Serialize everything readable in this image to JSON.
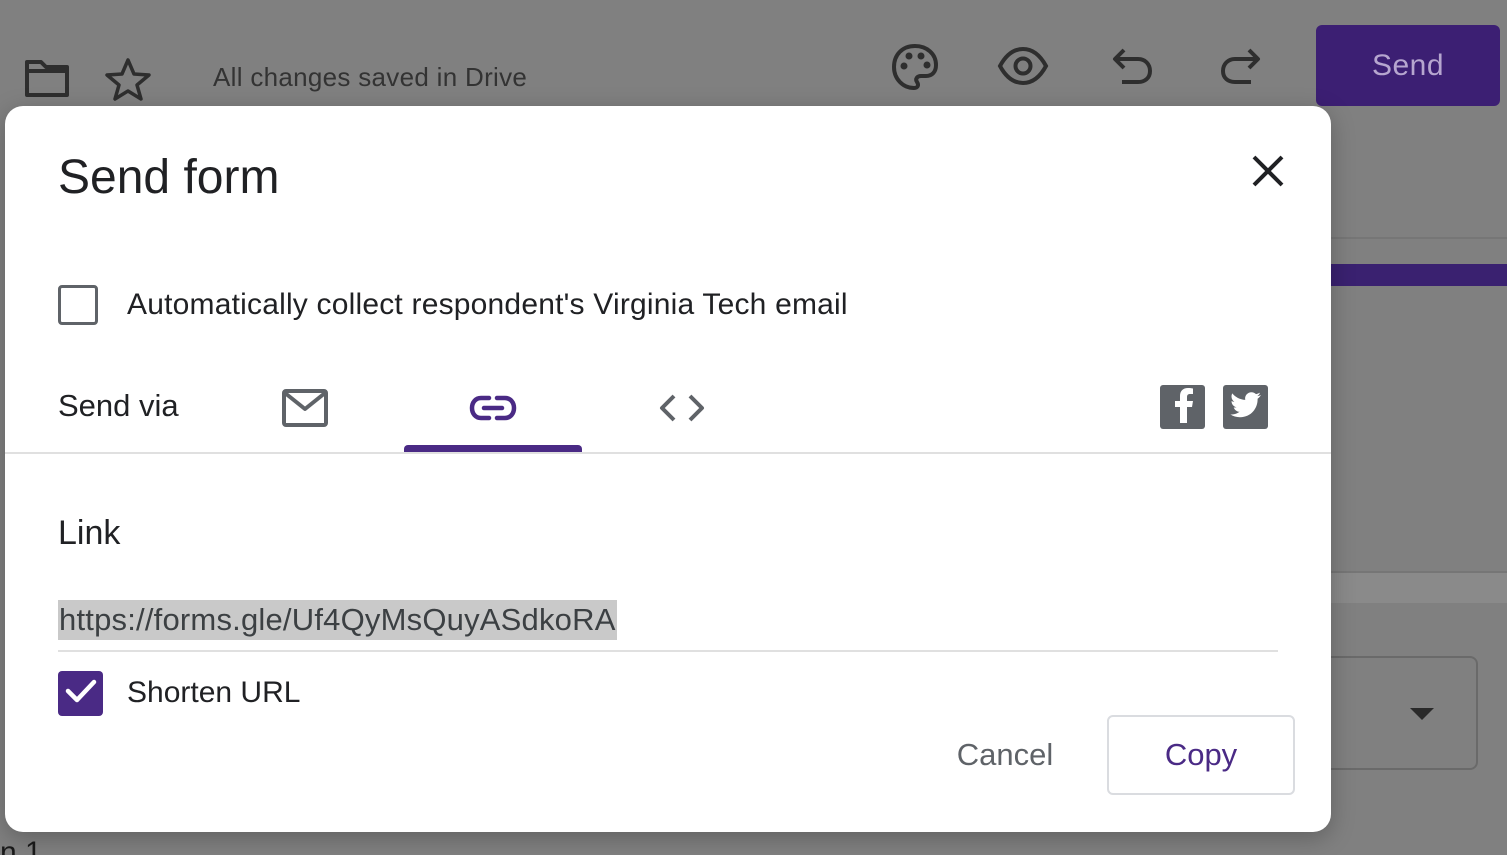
{
  "background": {
    "status_text": "All changes saved in Drive",
    "send_button_label": "Send",
    "edge_text": "n 1",
    "icons": [
      "folder-icon",
      "star-icon",
      "palette-icon",
      "eye-icon",
      "undo-icon",
      "redo-icon",
      "dropdown-arrow-icon"
    ]
  },
  "dialog": {
    "title": "Send form",
    "close_icon": "close-icon",
    "collect_email": {
      "label": "Automatically collect respondent's Virginia Tech email",
      "checked": false
    },
    "send_via": {
      "label": "Send via",
      "tabs": [
        {
          "icon": "email-icon",
          "selected": false
        },
        {
          "icon": "link-icon",
          "selected": true
        },
        {
          "icon": "embed-code-icon",
          "selected": false
        }
      ],
      "social": [
        "facebook-icon",
        "twitter-icon"
      ]
    },
    "link": {
      "heading": "Link",
      "url": "https://forms.gle/Uf4QyMsQuyASdkoRA",
      "shorten_label": "Shorten URL",
      "shorten_checked": true
    },
    "actions": {
      "cancel_label": "Cancel",
      "copy_label": "Copy"
    }
  },
  "colors": {
    "accent": "#4a2a85",
    "overlay": "#808080",
    "send_button_dimmed": "#3c1f73"
  }
}
